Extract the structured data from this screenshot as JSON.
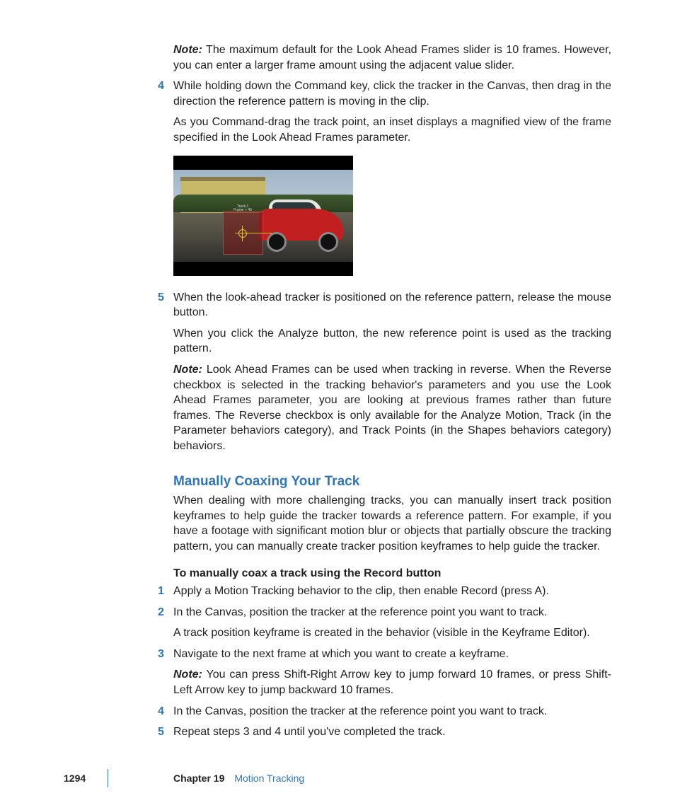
{
  "labels": {
    "note": "Note:"
  },
  "top_note": "The maximum default for the Look Ahead Frames slider is 10 frames. However, you can enter a larger frame amount using the adjacent value slider.",
  "step4": {
    "num": "4",
    "body": "While holding down the Command key, click the tracker in the Canvas, then drag in the direction the reference pattern is moving in the clip.",
    "sub": "As you Command-drag the track point, an inset displays a magnified view of the frame specified in the Look Ahead Frames parameter."
  },
  "figure": {
    "overlay_line1": "Track 1",
    "overlay_line2": "Frame + 45"
  },
  "step5": {
    "num": "5",
    "body": "When the look-ahead tracker is positioned on the reference pattern, release the mouse button.",
    "sub": "When you click the Analyze button, the new reference point is used as the tracking pattern.",
    "note": "Look Ahead Frames can be used when tracking in reverse. When the Reverse checkbox is selected in the tracking behavior's parameters and you use the Look Ahead Frames parameter, you are looking at previous frames rather than future frames. The Reverse checkbox is only available for the Analyze Motion, Track (in the Parameter behaviors category), and Track Points (in the Shapes behaviors category) behaviors."
  },
  "section": {
    "heading": "Manually Coaxing Your Track",
    "intro": "When dealing with more challenging tracks, you can manually insert track position keyframes to help guide the tracker towards a reference pattern. For example, if you have a footage with significant motion blur or objects that partially obscure the tracking pattern, you can manually create tracker position keyframes to help guide the tracker.",
    "sub_heading": "To manually coax a track using the Record button",
    "steps": {
      "s1": {
        "num": "1",
        "body": "Apply a Motion Tracking behavior to the clip, then enable Record (press A)."
      },
      "s2": {
        "num": "2",
        "body": "In the Canvas, position the tracker at the reference point you want to track.",
        "sub": "A track position keyframe is created in the behavior (visible in the Keyframe Editor)."
      },
      "s3": {
        "num": "3",
        "body": "Navigate to the next frame at which you want to create a keyframe.",
        "note": "You can press Shift-Right Arrow key to jump forward 10 frames, or press Shift-Left Arrow key to jump backward 10 frames."
      },
      "s4": {
        "num": "4",
        "body": "In the Canvas, position the tracker at the reference point you want to track."
      },
      "s5": {
        "num": "5",
        "body": "Repeat steps 3 and 4 until you've completed the track."
      }
    }
  },
  "footer": {
    "page": "1294",
    "chapter_label": "Chapter 19",
    "chapter_title": "Motion Tracking"
  }
}
